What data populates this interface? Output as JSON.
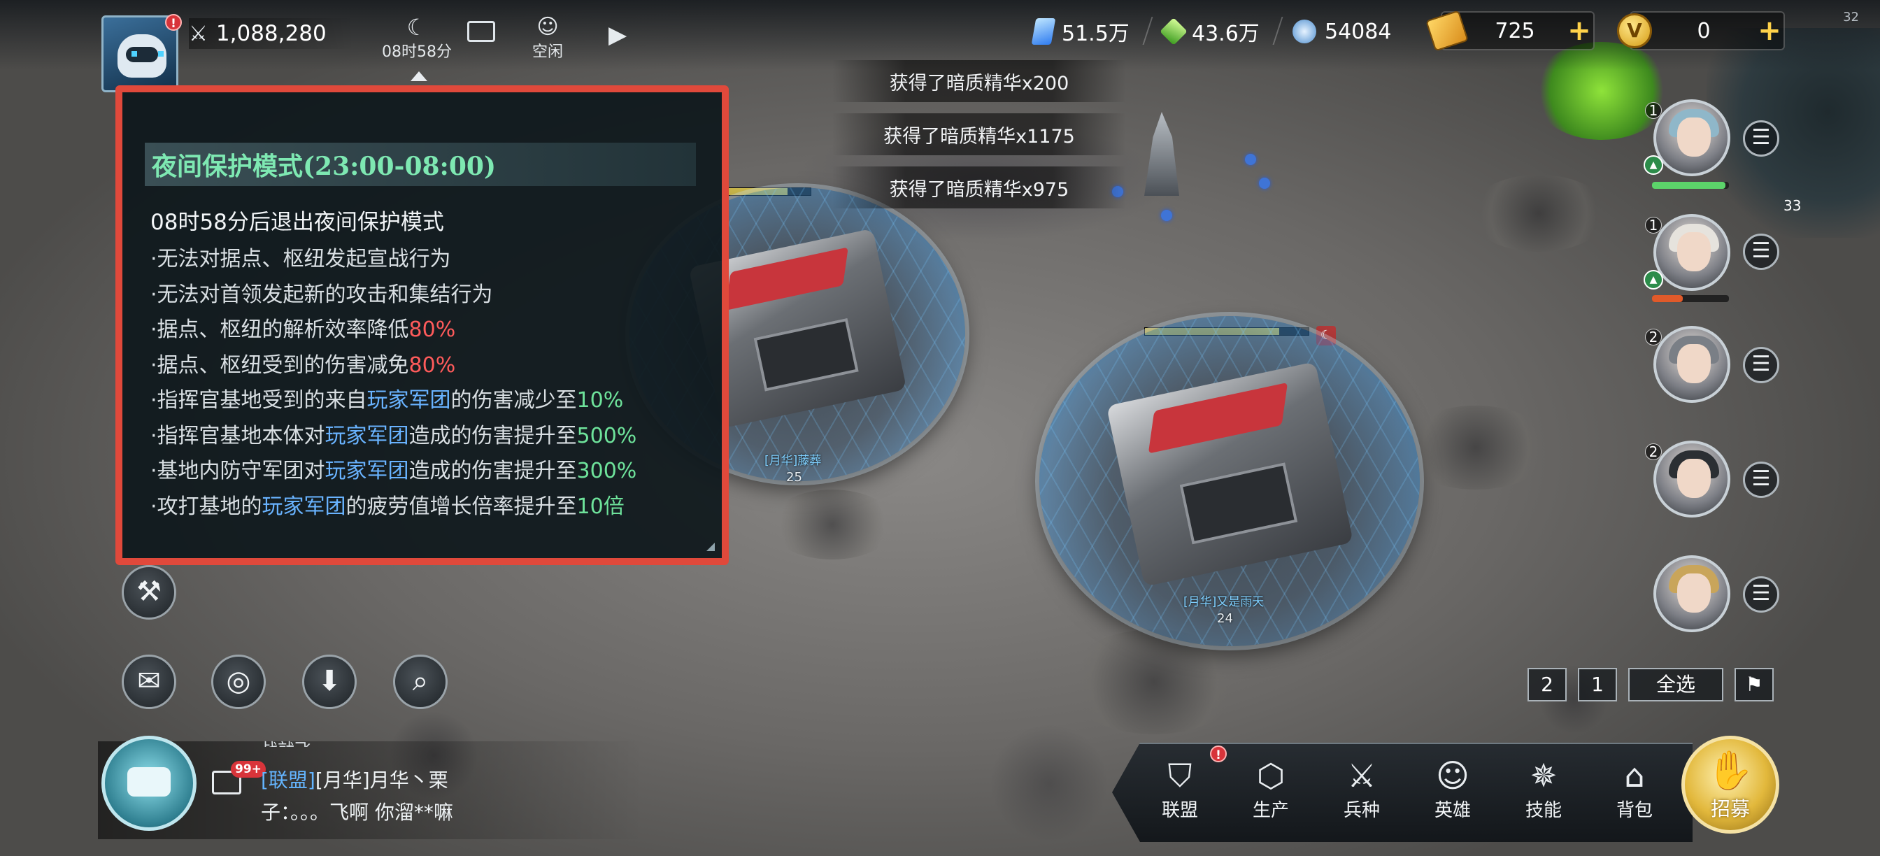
{
  "topbar": {
    "power": "1,088,280",
    "night_timer": "08时58分",
    "idle_label": "空闲",
    "resources": [
      {
        "value": "51.5万",
        "icon": "blue-crystal-icon",
        "color": "#4fa3ff"
      },
      {
        "value": "43.6万",
        "icon": "green-crystal-icon",
        "color": "#5fcf3a"
      },
      {
        "value": "54084",
        "icon": "blue-ore-icon",
        "color": "#7fb8e0"
      }
    ],
    "premium1": "725",
    "premium2": "0",
    "corner_num": "32"
  },
  "toasts": [
    "获得了暗质精华x200",
    "获得了暗质精华x1175",
    "获得了暗质精华x975"
  ],
  "tooltip": {
    "title": "夜间保护模式(23:00-08:00)",
    "subtitle": "08时58分后退出夜间保护模式",
    "lines": [
      {
        "text": "·无法对据点、枢纽发起宣战行为"
      },
      {
        "text": "·无法对首领发起新的攻击和集结行为"
      },
      {
        "pre": "·据点、枢纽的解析效率降低",
        "hl": "80%"
      },
      {
        "pre": "·据点、枢纽受到的伤害减免",
        "hl": "80%"
      },
      {
        "pre": "·指挥官基地受到的来自",
        "blue": "玩家军团",
        "mid": "的伤害减少至",
        "val": "10%"
      },
      {
        "pre": "·指挥官基地本体对",
        "blue": "玩家军团",
        "mid": "造成的伤害提升至",
        "val": "500%"
      },
      {
        "pre": "·基地内防守军团对",
        "blue": "玩家军团",
        "mid": "造成的伤害提升至",
        "val": "300%"
      },
      {
        "pre": "·攻打基地的",
        "blue": "玩家军团",
        "mid": "的疲劳值增长倍率提升至",
        "val": "10倍"
      }
    ]
  },
  "bases": [
    {
      "name": "[月华]藤葬",
      "level": "25",
      "hp": 0.72
    },
    {
      "name": "[月华]又是雨天",
      "level": "24",
      "hp": 0.82
    }
  ],
  "chat": {
    "badge": "99+",
    "tag": "[联盟]",
    "line1_rest": "[月华]月华丶栗",
    "line2": "子：。。。飞啊 你溜**嘛",
    "partial_top": "战就飞"
  },
  "heroes": [
    {
      "level": "1",
      "hp": 0.95,
      "hp_color": "#5cd36a",
      "hair": "#8fb7c9"
    },
    {
      "level": "1",
      "hp": 0.4,
      "hp_color": "#e05a2a",
      "hair": "#e6e3dd"
    },
    {
      "level": "2",
      "hair": "#7a7f86"
    },
    {
      "level": "2",
      "hair": "#2b2f33"
    },
    {
      "level": "",
      "hair": "#c9a55a"
    }
  ],
  "side_num": "33",
  "select": {
    "a": "2",
    "b": "1",
    "all": "全选"
  },
  "dock": {
    "items": [
      "联盟",
      "生产",
      "兵种",
      "英雄",
      "技能",
      "背包"
    ],
    "recruit": "招募"
  }
}
